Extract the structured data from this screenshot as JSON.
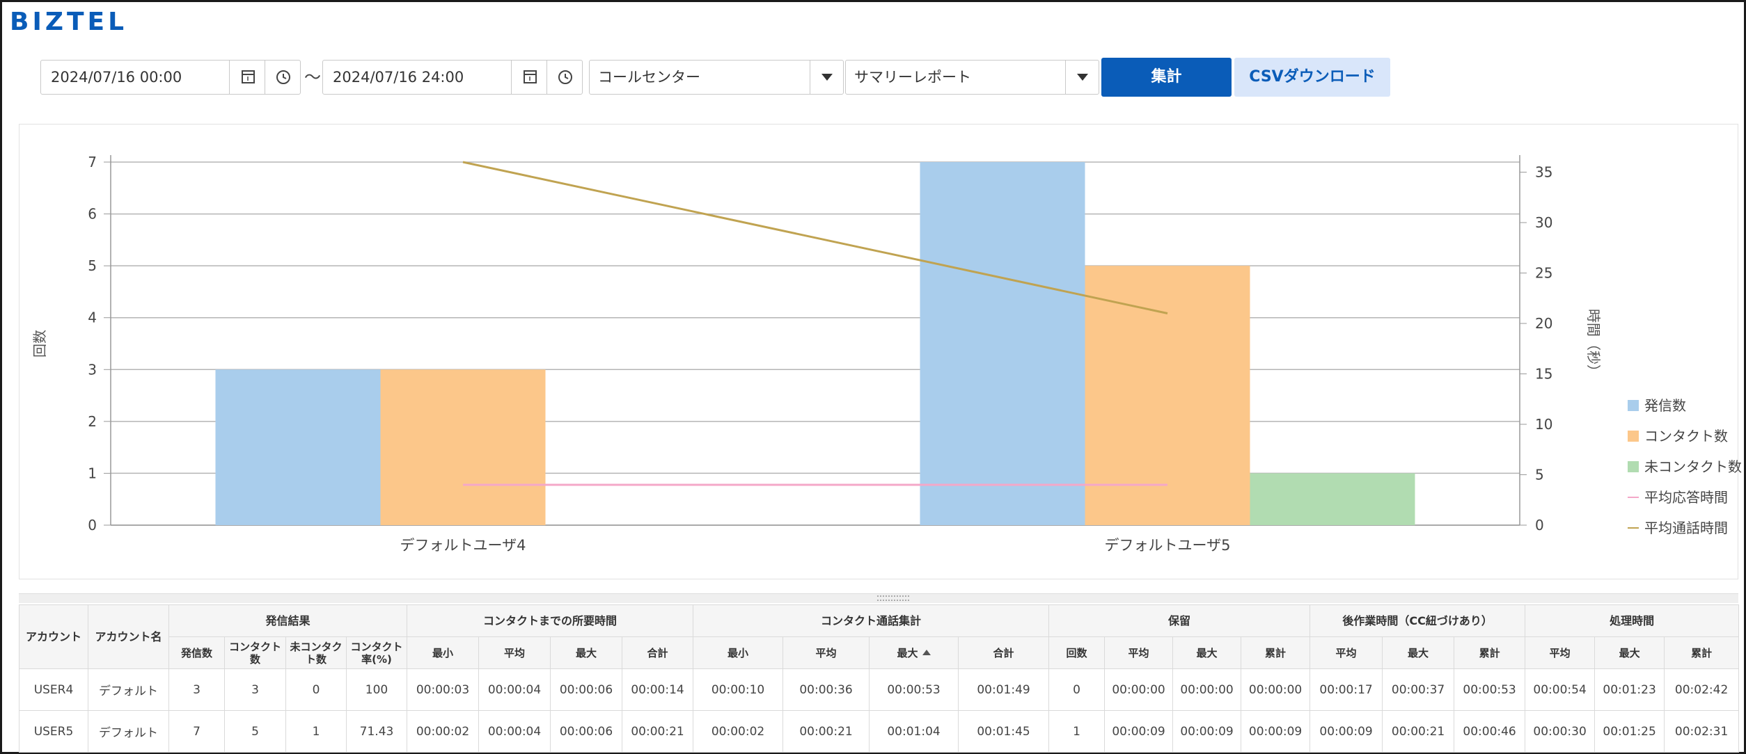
{
  "app": {
    "logo": "BIZTEL"
  },
  "toolbar": {
    "start_datetime": "2024/07/16 00:00",
    "separator": "～",
    "end_datetime": "2024/07/16 24:00",
    "scope_select": "コールセンター",
    "report_select": "サマリーレポート",
    "aggregate_label": "集計",
    "csv_label": "CSVダウンロード"
  },
  "icons": {
    "calendar": "calendar-icon",
    "clock": "clock-icon",
    "dropdown": "caret-down-icon"
  },
  "chart_data": {
    "type": "bar",
    "categories": [
      "デフォルトユーザ4",
      "デフォルトユーザ5"
    ],
    "series": [
      {
        "name": "発信数",
        "values": [
          3,
          7
        ],
        "color": "#a9cdec",
        "axis": "left",
        "kind": "bar"
      },
      {
        "name": "コンタクト数",
        "values": [
          3,
          5
        ],
        "color": "#fcc78a",
        "axis": "left",
        "kind": "bar"
      },
      {
        "name": "未コンタクト数",
        "values": [
          0,
          1
        ],
        "color": "#b1dcb1",
        "axis": "left",
        "kind": "bar"
      },
      {
        "name": "平均応答時間",
        "values": [
          4,
          4
        ],
        "color": "#f4a8c8",
        "axis": "right",
        "kind": "line"
      },
      {
        "name": "平均通話時間",
        "values": [
          36,
          21
        ],
        "color": "#c0a351",
        "axis": "right",
        "kind": "line"
      }
    ],
    "ylabel": "回数",
    "y2label": "時間（秒）",
    "ylim": [
      0,
      7
    ],
    "y2lim": [
      0,
      36
    ],
    "yticks": [
      "0",
      "1",
      "2",
      "3",
      "4",
      "5",
      "6",
      "7"
    ],
    "y2ticks": [
      "0",
      "5",
      "10",
      "15",
      "20",
      "25",
      "30",
      "35"
    ],
    "grid": true,
    "legend": "right"
  },
  "table": {
    "groups": {
      "account": "アカウント",
      "account_name": "アカウント名",
      "outgoing": "発信結果",
      "time_to_contact": "コンタクトまでの所要時間",
      "contact_talk": "コンタクト通話集計",
      "hold": "保留",
      "after_work": "後作業時間（CC紐づけあり）",
      "processing": "処理時間"
    },
    "subs": {
      "outgoing": [
        "発信数",
        "コンタクト数",
        "未コンタクト数",
        "コンタクト率(%)"
      ],
      "time_to_contact": [
        "最小",
        "平均",
        "最大",
        "合計"
      ],
      "contact_talk": [
        "最小",
        "平均",
        "最大",
        "合計"
      ],
      "hold": [
        "回数",
        "平均",
        "最大",
        "累計"
      ],
      "after_work": [
        "平均",
        "最大",
        "累計"
      ],
      "processing": [
        "平均",
        "最大",
        "累計"
      ]
    },
    "rows": [
      [
        "USER4",
        "デフォルト",
        "3",
        "3",
        "0",
        "100",
        "00:00:03",
        "00:00:04",
        "00:00:06",
        "00:00:14",
        "00:00:10",
        "00:00:36",
        "00:00:53",
        "00:01:49",
        "0",
        "00:00:00",
        "00:00:00",
        "00:00:00",
        "00:00:17",
        "00:00:37",
        "00:00:53",
        "00:00:54",
        "00:01:23",
        "00:02:42"
      ],
      [
        "USER5",
        "デフォルト",
        "7",
        "5",
        "1",
        "71.43",
        "00:00:02",
        "00:00:04",
        "00:00:06",
        "00:00:21",
        "00:00:02",
        "00:00:21",
        "00:01:04",
        "00:01:45",
        "1",
        "00:00:09",
        "00:00:09",
        "00:00:09",
        "00:00:09",
        "00:00:21",
        "00:00:46",
        "00:00:30",
        "00:01:25",
        "00:02:31"
      ]
    ]
  }
}
